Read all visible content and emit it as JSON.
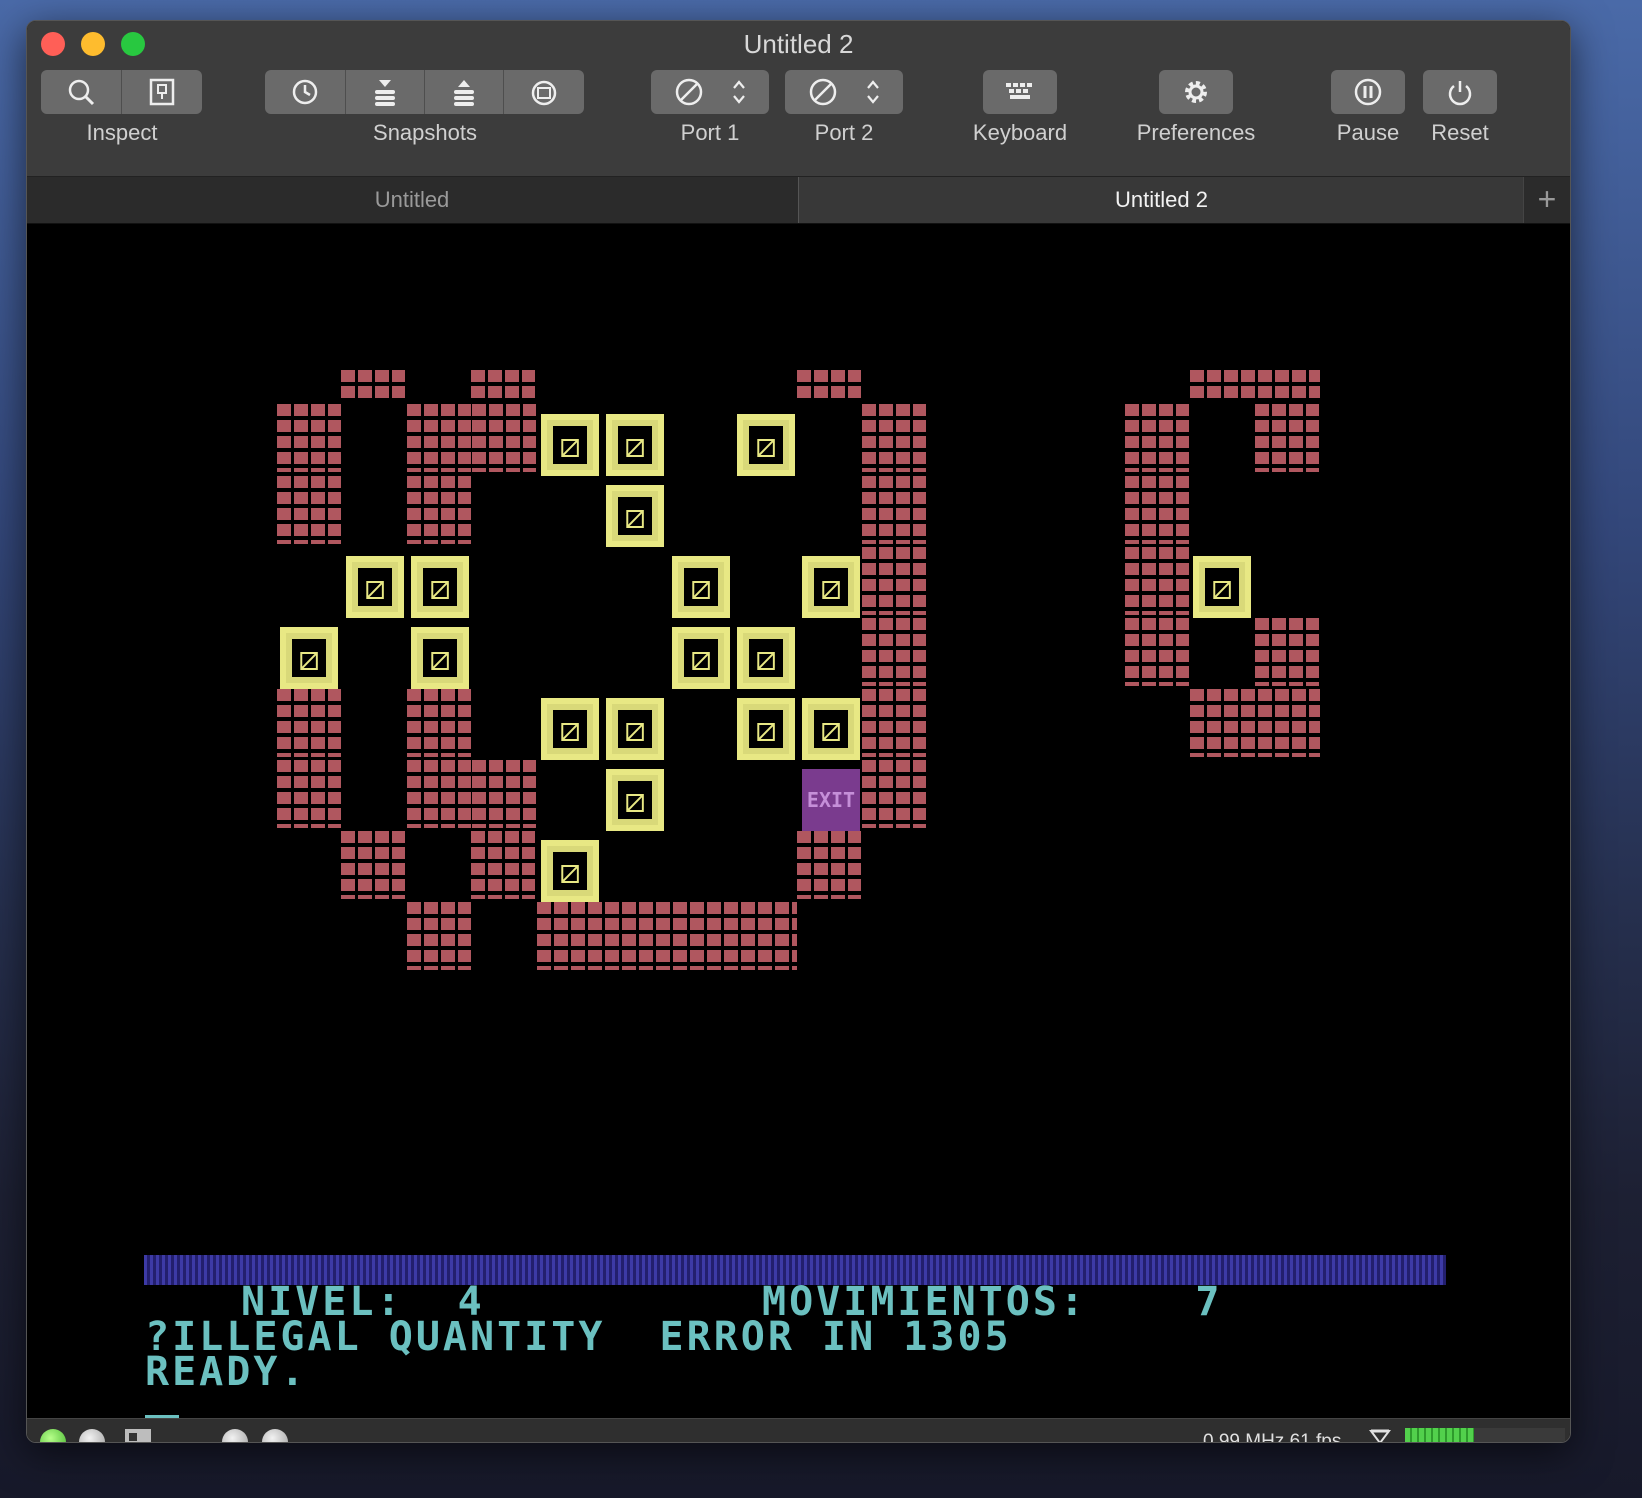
{
  "window": {
    "title": "Untitled 2"
  },
  "toolbar": {
    "inspect": {
      "label": "Inspect",
      "icons": [
        "magnifier-icon",
        "document-icon"
      ]
    },
    "snapshots": {
      "label": "Snapshots",
      "icons": [
        "clock-back-icon",
        "stack-down-icon",
        "stack-up-icon",
        "restore-icon"
      ]
    },
    "port1": {
      "label": "Port 1",
      "icons": [
        "none-icon",
        "updown-icon"
      ]
    },
    "port2": {
      "label": "Port 2",
      "icons": [
        "none-icon",
        "updown-icon"
      ]
    },
    "keyboard": {
      "label": "Keyboard",
      "icon": "keyboard-icon"
    },
    "preferences": {
      "label": "Preferences",
      "icon": "gear-icon"
    },
    "pause": {
      "label": "Pause",
      "icon": "pause-icon"
    },
    "reset": {
      "label": "Reset",
      "icon": "power-icon"
    }
  },
  "tabs": [
    {
      "label": "Untitled",
      "active": false
    },
    {
      "label": "Untitled 2",
      "active": true
    }
  ],
  "game": {
    "exit_label": "EXIT",
    "colors": {
      "brick": "#b0575f",
      "crate": "#e8e884",
      "exit": "#7a3b8e",
      "text": "#6bc0c0",
      "bar": "#3d3aa6"
    }
  },
  "console": {
    "line1_left": "NIVEL:  4",
    "line1_right": "MOVIMIENTOS:    7",
    "line2": "?ILLEGAL QUANTITY  ERROR IN 1305",
    "line3": "READY."
  },
  "status": {
    "speed_text": "0.99 MHz 61 fps",
    "speed_level": 0.43
  }
}
